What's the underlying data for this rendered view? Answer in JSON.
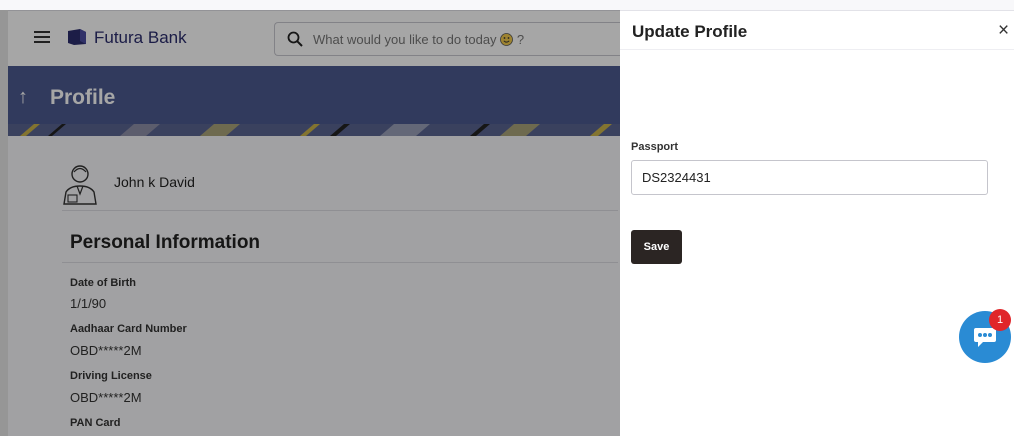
{
  "header": {
    "brand_name": "Futura Bank",
    "search_placeholder": "What would you like to do today",
    "search_suffix": "?"
  },
  "banner": {
    "back_symbol": "↑",
    "title": "Profile"
  },
  "profile": {
    "user_name": "John k David",
    "section_title": "Personal Information",
    "fields": [
      {
        "label": "Date of Birth",
        "value": "1/1/90"
      },
      {
        "label": "Aadhaar Card Number",
        "value": "OBD*****2M"
      },
      {
        "label": "Driving License",
        "value": "OBD*****2M"
      },
      {
        "label": "PAN Card",
        "value": ""
      }
    ]
  },
  "panel": {
    "title": "Update Profile",
    "close_symbol": "×",
    "passport_label": "Passport",
    "passport_value": "DS2324431",
    "save_label": "Save"
  },
  "chat": {
    "badge_count": "1"
  },
  "colors": {
    "banner": "#4c5a8f",
    "brand_text": "#2b2d6e",
    "save_button": "#2b2523",
    "chat_button": "#2a8bd4",
    "badge": "#e0262a"
  },
  "icons": [
    "hamburger-icon",
    "bank-logo-icon",
    "search-icon",
    "smiley-icon",
    "back-arrow-icon",
    "user-avatar-icon",
    "close-icon",
    "chat-icon"
  ]
}
